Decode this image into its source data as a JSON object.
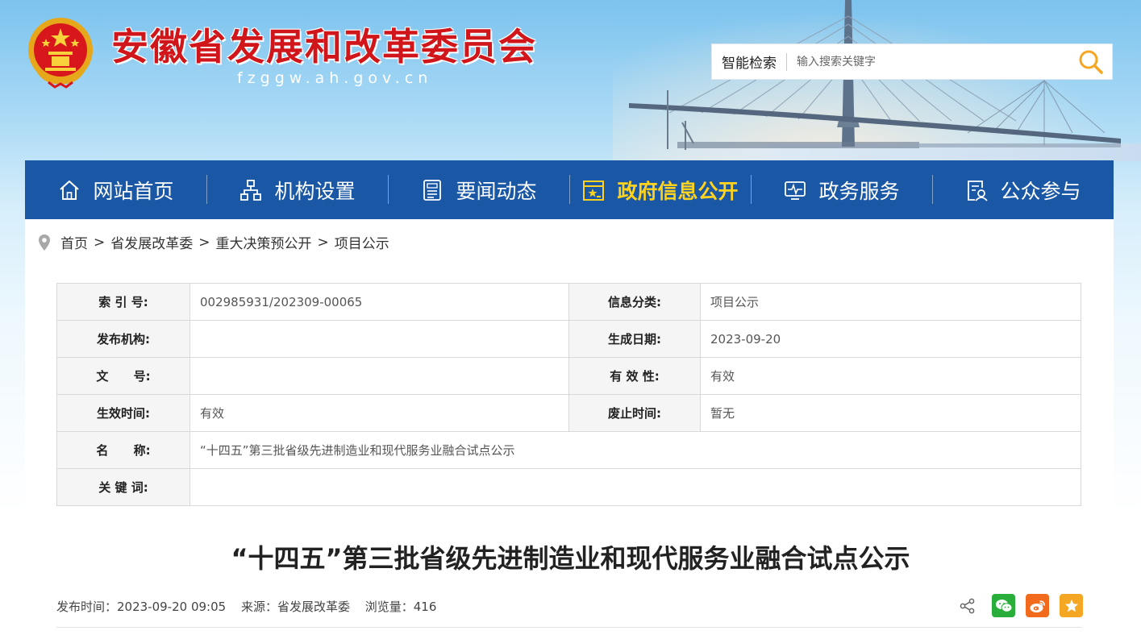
{
  "header": {
    "title": "安徽省发展和改革委员会",
    "domain": "fzggw.ah.gov.cn"
  },
  "search": {
    "label": "智能检索",
    "placeholder": "输入搜索关键字"
  },
  "nav": {
    "items": [
      {
        "label": "网站首页",
        "icon": "home-icon"
      },
      {
        "label": "机构设置",
        "icon": "org-chart-icon"
      },
      {
        "label": "要闻动态",
        "icon": "news-icon"
      },
      {
        "label": "政府信息公开",
        "icon": "gov-info-icon",
        "active": true
      },
      {
        "label": "政务服务",
        "icon": "service-icon"
      },
      {
        "label": "公众参与",
        "icon": "participation-icon"
      }
    ]
  },
  "breadcrumb": {
    "items": [
      "首页",
      "省发展改革委",
      "重大决策预公开",
      "项目公示"
    ],
    "separator": ">"
  },
  "info": {
    "index_no_label": "索 引 号:",
    "index_no": "002985931/202309-00065",
    "category_label": "信息分类:",
    "category": "项目公示",
    "publisher_label": "发布机构:",
    "publisher": "",
    "created_label": "生成日期:",
    "created": "2023-09-20",
    "doc_no_label": "文      号:",
    "doc_no": "",
    "validity_label": "有 效 性:",
    "validity": "有效",
    "effective_label": "生效时间:",
    "effective": "有效",
    "expire_label": "废止时间:",
    "expire": "暂无",
    "name_label": "名      称:",
    "name": "“十四五”第三批省级先进制造业和现代服务业融合试点公示",
    "keywords_label": "关 键 词:",
    "keywords": ""
  },
  "article": {
    "title": "“十四五”第三批省级先进制造业和现代服务业融合试点公示",
    "publish_time": "发布时间：2023-09-20 09:05",
    "source": "来源：省发展改革委",
    "views": "浏览量：416"
  },
  "colors": {
    "nav_bg": "#1a57a5",
    "nav_active": "#ffd21e",
    "title_red": "#d1161b",
    "wechat": "#2aae3b",
    "weibo": "#f26a1b",
    "favorite": "#f5a623"
  }
}
